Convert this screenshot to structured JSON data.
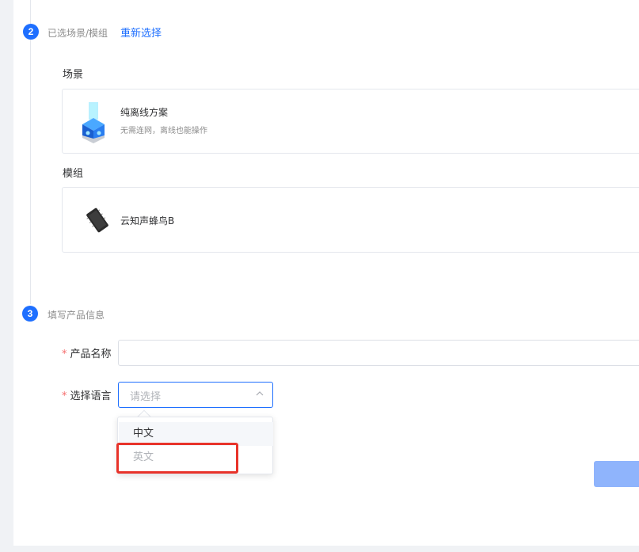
{
  "steps": {
    "step2": {
      "number": "2",
      "title": "已选场景/模组",
      "reselect_link": "重新选择",
      "scene_label": "场景",
      "scene_card": {
        "title": "纯离线方案",
        "description": "无需连网，离线也能操作",
        "icon": "offline-cube-icon"
      },
      "module_label": "模组",
      "module_card": {
        "title": "云知声蜂鸟B",
        "icon": "chip-module-icon"
      }
    },
    "step3": {
      "number": "3",
      "title": "填写产品信息",
      "required_mark": "*",
      "product_name_label": "产品名称",
      "product_name_value": "",
      "language_label": "选择语言",
      "language_placeholder": "请选择",
      "language_options": [
        {
          "label": "中文",
          "state": "hover"
        },
        {
          "label": "英文",
          "state": "disabled"
        }
      ]
    }
  },
  "colors": {
    "accent": "#1e6fff",
    "required": "#f56c6c",
    "highlight_box": "#e8332a",
    "button_disabled": "#8fb4fc"
  }
}
